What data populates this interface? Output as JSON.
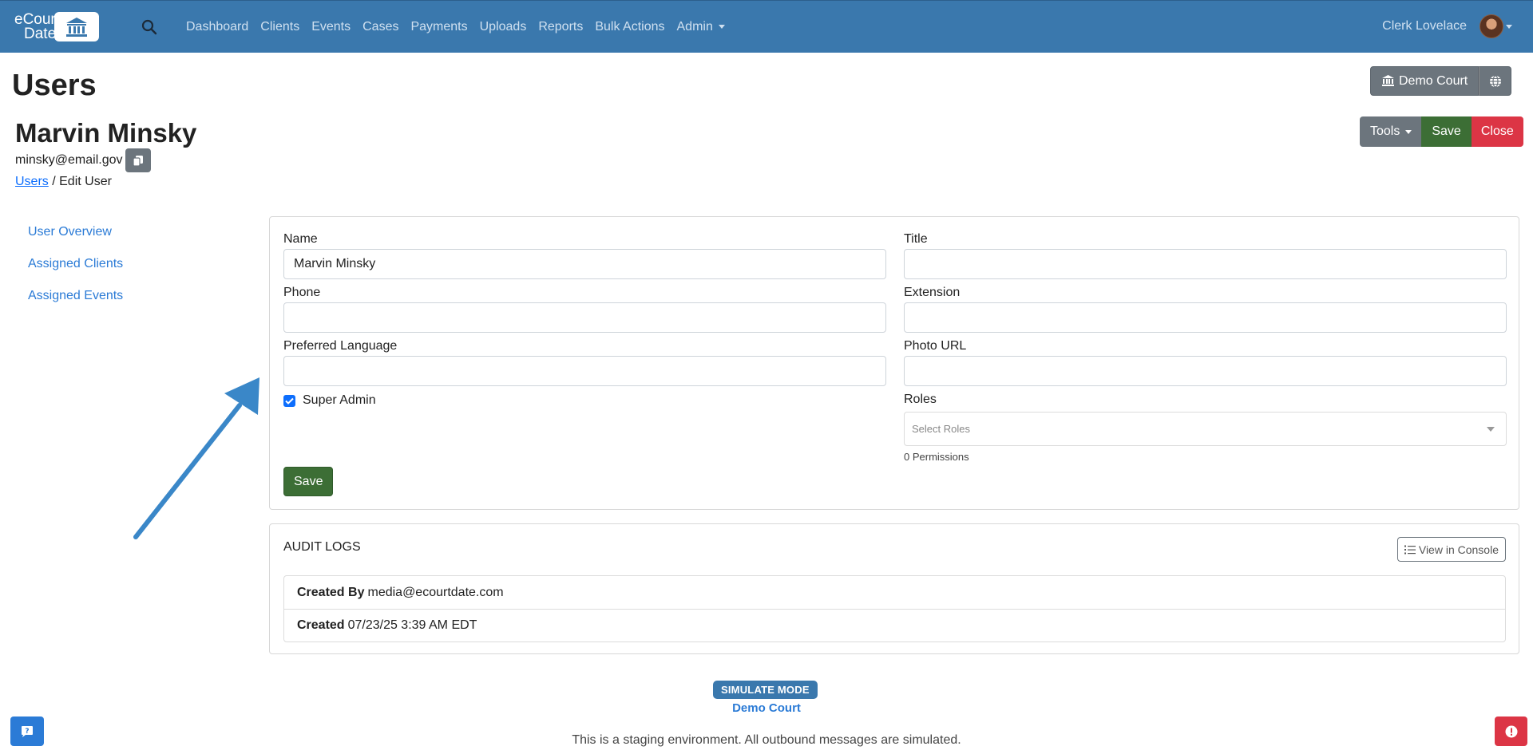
{
  "navbar": {
    "logo_line1": "eCourt",
    "logo_line2": "Date",
    "links": [
      "Dashboard",
      "Clients",
      "Events",
      "Cases",
      "Payments",
      "Uploads",
      "Reports",
      "Bulk Actions"
    ],
    "admin_label": "Admin",
    "user_name": "Clerk Lovelace"
  },
  "header": {
    "page_title": "Users",
    "court_button": "Demo Court",
    "user_full_name": "Marvin Minsky",
    "email": "minsky@email.gov",
    "tools_label": "Tools",
    "save_label": "Save",
    "close_label": "Close",
    "breadcrumb_link": "Users",
    "breadcrumb_current": "/ Edit User"
  },
  "sidebar": {
    "items": [
      "User Overview",
      "Assigned Clients",
      "Assigned Events"
    ]
  },
  "form": {
    "name_label": "Name",
    "name_value": "Marvin Minsky",
    "title_label": "Title",
    "title_value": "",
    "phone_label": "Phone",
    "phone_value": "",
    "extension_label": "Extension",
    "extension_value": "",
    "language_label": "Preferred Language",
    "language_value": "",
    "photo_label": "Photo URL",
    "photo_value": "",
    "super_admin_label": "Super Admin",
    "super_admin_checked": true,
    "roles_label": "Roles",
    "roles_placeholder": "Select Roles",
    "permissions_text": "0 Permissions",
    "save_label": "Save"
  },
  "audit": {
    "title": "AUDIT LOGS",
    "console_button": "View in Console",
    "rows": [
      {
        "label": "Created By",
        "value": "media@ecourtdate.com"
      },
      {
        "label": "Created",
        "value": "07/23/25 3:39 AM EDT"
      }
    ]
  },
  "footer": {
    "badge": "SIMULATE MODE",
    "court": "Demo Court",
    "staging_text": "This is a staging environment. All outbound messages are simulated."
  },
  "colors": {
    "navbar": "#3a78ad",
    "save": "#3c6e35",
    "close": "#dc3545",
    "link": "#2b7bd6",
    "arrow": "#3a87c8"
  }
}
